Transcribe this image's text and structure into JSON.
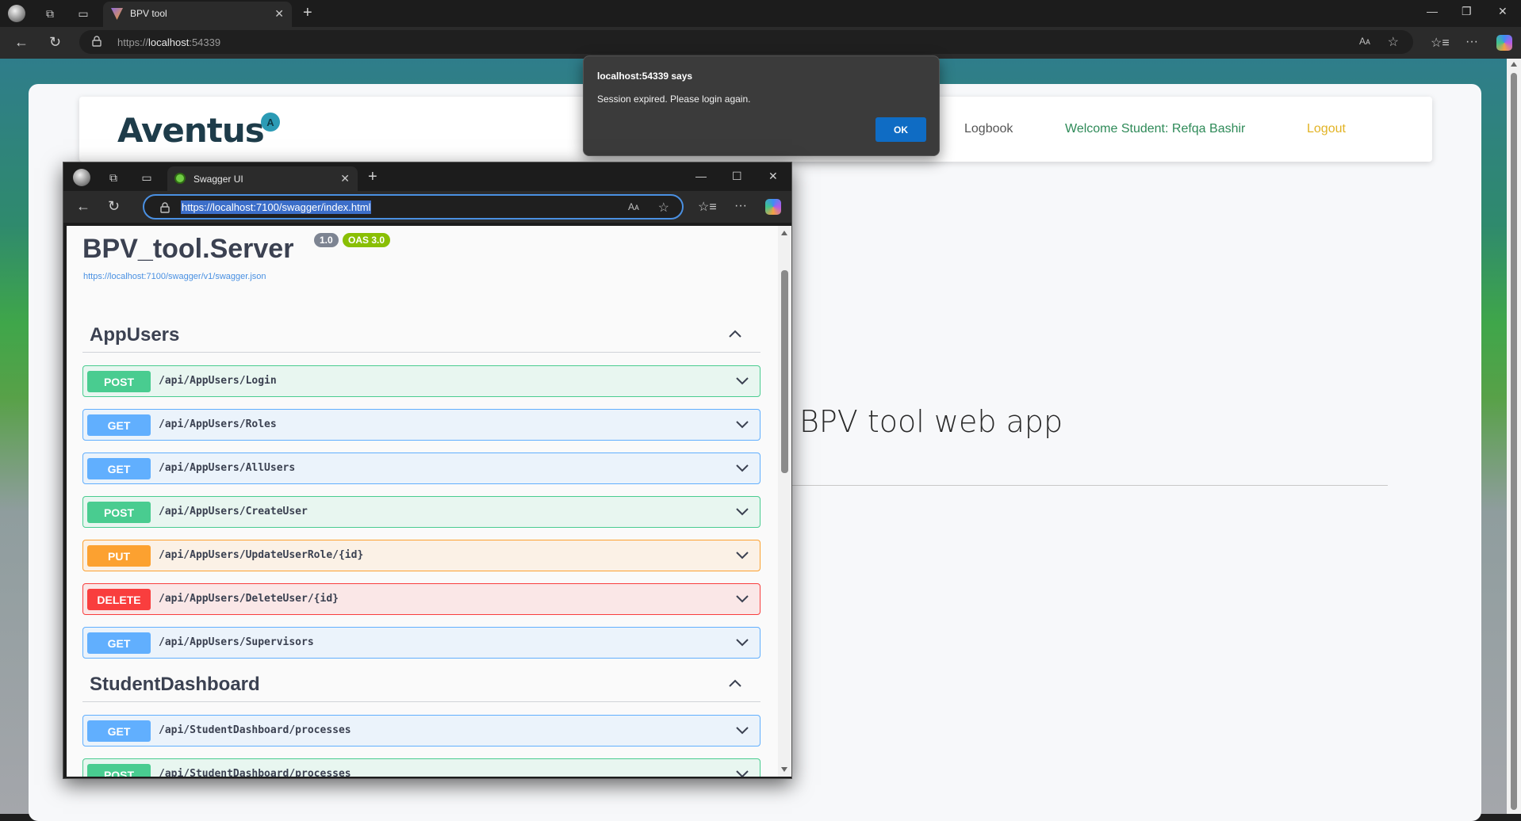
{
  "main_browser": {
    "tab_title": "BPV tool",
    "url_prefix": "https://",
    "url_host": "localhost",
    "url_port": ":54339",
    "read_aloud": "Aᴀ"
  },
  "site": {
    "logo_text": "Aventus",
    "logo_badge": "A",
    "nav": {
      "logbook": "Logbook",
      "welcome": "Welcome Student: Refqa Bashir",
      "logout": "Logout"
    },
    "hero_title": "BPV tool web app"
  },
  "alert": {
    "title": "localhost:54339 says",
    "message": "Session expired. Please login again.",
    "ok_label": "OK"
  },
  "swagger_window": {
    "tab_title": "Swagger UI",
    "url": "https://localhost:7100/swagger/index.html",
    "read_aloud": "Aᴀ"
  },
  "swagger": {
    "title": "BPV_tool.Server",
    "version": "1.0",
    "oas": "OAS 3.0",
    "spec_link": "https://localhost:7100/swagger/v1/swagger.json",
    "sections": [
      {
        "name": "AppUsers",
        "operations": [
          {
            "method": "POST",
            "path": "/api/AppUsers/Login"
          },
          {
            "method": "GET",
            "path": "/api/AppUsers/Roles"
          },
          {
            "method": "GET",
            "path": "/api/AppUsers/AllUsers"
          },
          {
            "method": "POST",
            "path": "/api/AppUsers/CreateUser"
          },
          {
            "method": "PUT",
            "path": "/api/AppUsers/UpdateUserRole/{id}"
          },
          {
            "method": "DELETE",
            "path": "/api/AppUsers/DeleteUser/{id}"
          },
          {
            "method": "GET",
            "path": "/api/AppUsers/Supervisors"
          }
        ]
      },
      {
        "name": "StudentDashboard",
        "operations": [
          {
            "method": "GET",
            "path": "/api/StudentDashboard/processes"
          },
          {
            "method": "POST",
            "path": "/api/StudentDashboard/processes"
          }
        ]
      }
    ]
  },
  "colors": {
    "post": "#49cc90",
    "get": "#61affe",
    "put": "#fca130",
    "delete": "#f93e3e",
    "welcome": "#2e8a58",
    "logout": "#e2b324"
  }
}
